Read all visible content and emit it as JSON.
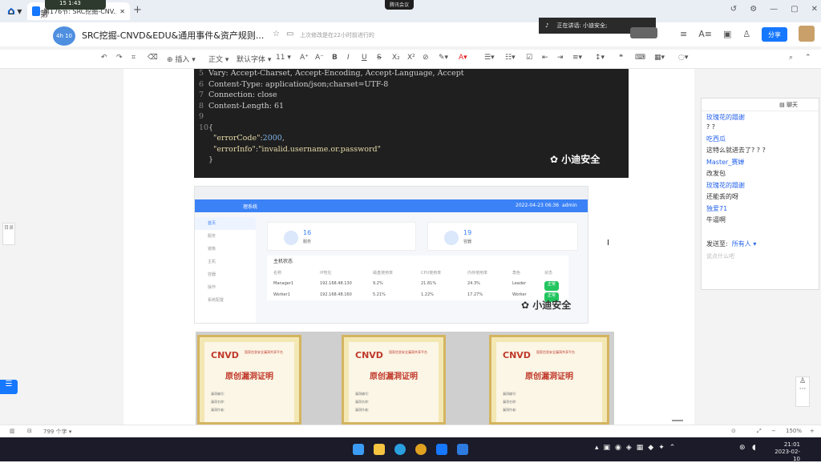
{
  "browser": {
    "tab_title": "第176节: SRC挖掘-CNV...",
    "rec_indicator": "15",
    "rec_time": "1:43",
    "meeting_chip": "腾讯会议",
    "new_tab": "+"
  },
  "doc": {
    "breadcrumb": "第",
    "avatar_text": "4h 10",
    "title": "SRC挖掘-CNVD&EDU&通用事件&资产规则...",
    "saved_status": "上次修改是在22小时前进行的",
    "speaking": "正在讲话: 小迪安全;",
    "share_label": "分享"
  },
  "toolbar": {
    "insert": "插入",
    "para_style": "正文",
    "font": "默认字体",
    "size": "11"
  },
  "code": {
    "lines": [
      {
        "n": "5",
        "text": "Vary: Accept-Charset, Accept-Encoding, Accept-Language, Accept"
      },
      {
        "n": "6",
        "text": "Content-Type: application/json;charset=UTF-8"
      },
      {
        "n": "7",
        "text": "Connection: close"
      },
      {
        "n": "8",
        "text": "Content-Length: 61"
      },
      {
        "n": "9",
        "text": ""
      },
      {
        "n": "10",
        "text": "{"
      }
    ],
    "error_code_key": "\"errorCode\"",
    "error_code_val": "2000",
    "error_info_key": "\"errorInfo\"",
    "error_info_val": "\"invalid.username.or.password\"",
    "close_brace": "}",
    "watermark": "小迪安全"
  },
  "screenshot2": {
    "system_name": "理系统",
    "datetime": "2022-04-23 06:36",
    "user": "admin",
    "side_items": [
      "首页",
      "服务",
      "镜像",
      "主机",
      "容器",
      "操作",
      "系统配置"
    ],
    "card1_value": "16",
    "card1_label": "服务",
    "card2_value": "19",
    "card2_label": "容器",
    "panel_title": "主机状态",
    "headers": [
      "名称",
      "IP地址",
      "磁盘使用率",
      "CPU使用率",
      "内存使用率",
      "角色",
      "状态"
    ],
    "rows": [
      [
        "Manager1",
        "192.168.48.130",
        "9.2%",
        "21.81%",
        "24.3%",
        "Leader",
        "正常"
      ],
      [
        "Worker1",
        "192.168.48.160",
        "5.21%",
        "1.22%",
        "17.27%",
        "Worker",
        "正常"
      ]
    ],
    "watermark": "小迪安全"
  },
  "certs": {
    "brand": "CNVD",
    "brand_sub": "国家信息安全漏洞共享平台",
    "title": "原创漏洞证明",
    "line1": "漏洞编号:",
    "line2": "漏洞名称:",
    "line3": "漏洞作者:"
  },
  "chat": {
    "title": "聊天",
    "messages": [
      {
        "who": "玫瑰花的蹋谢",
        "text": "? ?"
      },
      {
        "who": "吃西瓜",
        "text": "这特么就进去了? ? ?"
      },
      {
        "who": "Master_赛婵",
        "text": "改发包"
      },
      {
        "who": "玫瑰花的蹋谢",
        "text": "还能丢的呀"
      },
      {
        "who": "独爱71",
        "text": "牛逼啊"
      }
    ],
    "send_to_label": "发送至:",
    "send_to_value": "所有人",
    "input_placeholder": "说点什么吧"
  },
  "left_pin": "目录",
  "status": {
    "word_count": "799 个字",
    "zoom": "150%"
  },
  "clock": {
    "time": "21:01",
    "date": "2023-02-10"
  },
  "colors": {
    "accent": "#1677ff",
    "code_bg": "#1f1f1f",
    "cnvd_red": "#c0392b",
    "ok_green": "#22c55e"
  }
}
